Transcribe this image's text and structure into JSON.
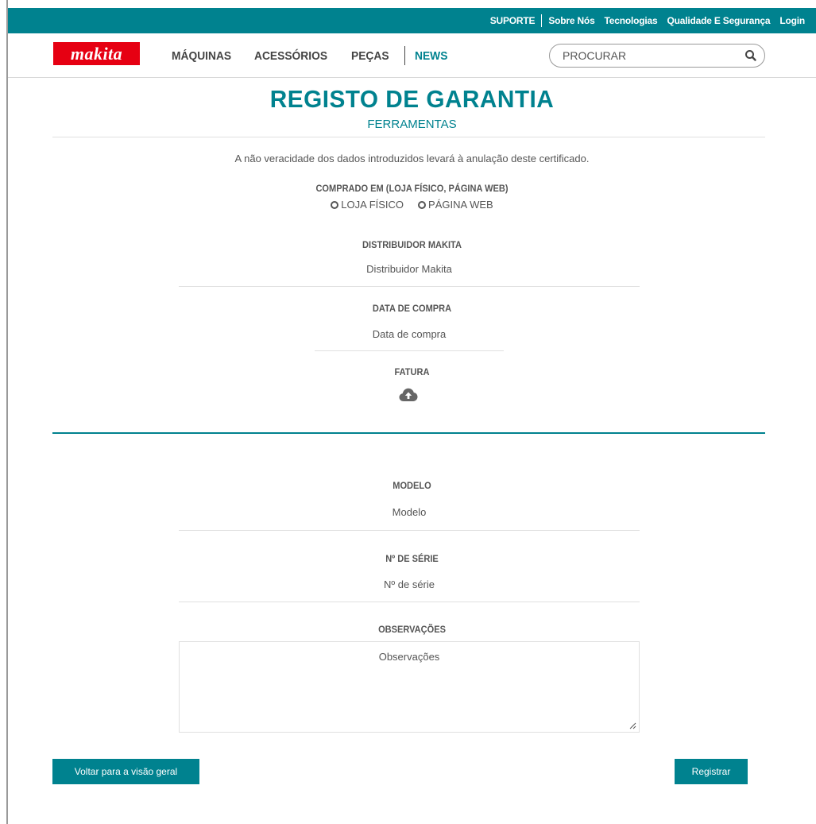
{
  "topbar": {
    "suporte": "SUPORTE",
    "sobre": "Sobre Nós",
    "tecnologias": "Tecnologias",
    "qualidade": "Qualidade E Segurança",
    "login": "Login"
  },
  "nav": {
    "logo": "makita",
    "maquinas": "MÁQUINAS",
    "acessorios": "ACESSÓRIOS",
    "pecas": "PEÇAS",
    "news": "NEWS",
    "search_placeholder": "PROCURAR"
  },
  "header": {
    "title": "REGISTO DE GARANTIA",
    "subtitle": "FERRAMENTAS"
  },
  "form": {
    "notice": "A não veracidade dos dados introduzidos levará à anulação deste certificado.",
    "comprado_label": "COMPRADO EM (LOJA FÍSICO, PÁGINA WEB)",
    "radio_loja": "LOJA FÍSICO",
    "radio_web": "PÁGINA WEB",
    "distribuidor_label": "DISTRIBUIDOR MAKITA",
    "distribuidor_placeholder": "Distribuidor Makita",
    "data_label": "DATA DE COMPRA",
    "data_placeholder": "Data de compra",
    "fatura_label": "FATURA",
    "modelo_label": "MODELO",
    "modelo_placeholder": "Modelo",
    "serie_label": "Nº DE SÉRIE",
    "serie_placeholder": "Nº de série",
    "obs_label": "OBSERVAÇÕES",
    "obs_placeholder": "Observações"
  },
  "buttons": {
    "back": "Voltar para a visão geral",
    "register": "Registrar"
  },
  "colors": {
    "accent": "#00828f",
    "logo_red": "#e60012"
  },
  "icons": {
    "search": "search-icon",
    "upload": "cloud-upload-icon"
  }
}
